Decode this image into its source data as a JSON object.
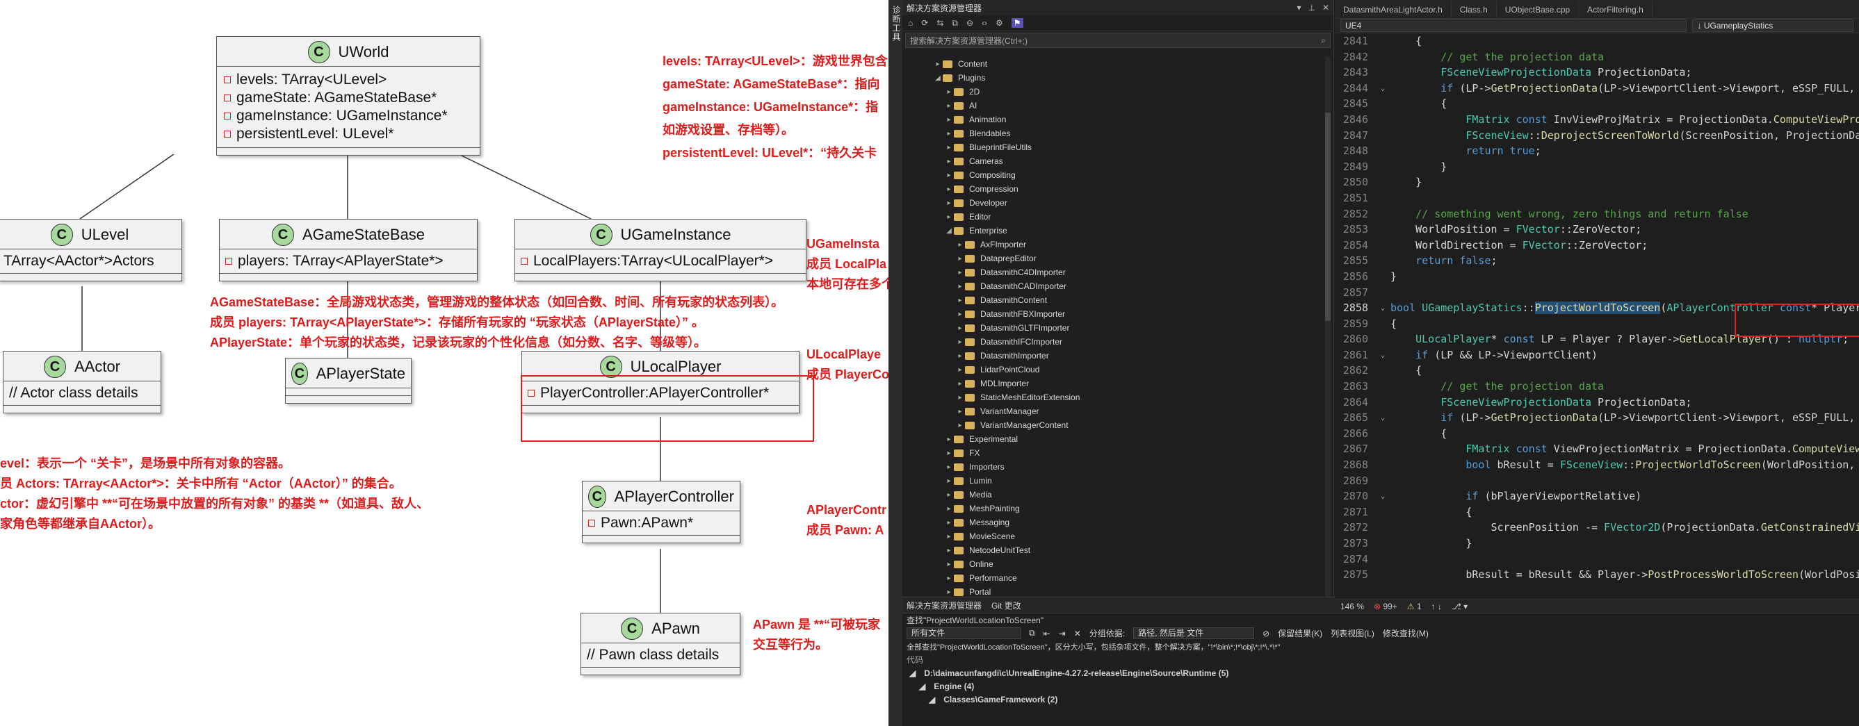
{
  "uml": {
    "classes": {
      "uworld": {
        "icon": "C",
        "name": "UWorld",
        "attrs": [
          "levels: TArray<ULevel>",
          "gameState: AGameStateBase*",
          "gameInstance: UGameInstance*",
          "persistentLevel: ULevel*"
        ]
      },
      "ulevel": {
        "icon": "C",
        "name": "ULevel",
        "attrs": [
          "TArray<AActor*>Actors"
        ]
      },
      "agamestatebase": {
        "icon": "C",
        "name": "AGameStateBase",
        "attrs": [
          "players: TArray<APlayerState*>"
        ]
      },
      "ugameinstance": {
        "icon": "C",
        "name": "UGameInstance",
        "attrs": [
          "LocalPlayers:TArray<ULocalPlayer*>"
        ]
      },
      "aactor": {
        "icon": "C",
        "name": "AActor",
        "attrs": [
          "// Actor class details"
        ]
      },
      "aplayerstate": {
        "icon": "C",
        "name": "APlayerState",
        "attrs": []
      },
      "ulocalplayer": {
        "icon": "C",
        "name": "ULocalPlayer",
        "attrs": [
          "PlayerController:APlayerController*"
        ]
      },
      "aplayercontroller": {
        "icon": "C",
        "name": "APlayerController",
        "attrs": [
          "Pawn:APawn*"
        ]
      },
      "apawn": {
        "icon": "C",
        "name": "APawn",
        "attrs": [
          "// Pawn class details"
        ]
      }
    },
    "notes": {
      "uworld": [
        "levels: TArray<ULevel>：游戏世界包含",
        "gameState: AGameStateBase*：指向",
        "gameInstance: UGameInstance*：指",
        "如游戏设置、存档等）。",
        "persistentLevel: ULevel*：“持久关卡"
      ],
      "agamestate": [
        "AGameStateBase：全局游戏状态类，管理游戏的整体状态（如回合数、时间、所有玩家的状态列表）。",
        "成员 players: TArray<APlayerState*>：存储所有玩家的 “玩家状态（APlayerState）” 。",
        "APlayerState：单个玩家的状态类，记录该玩家的个性化信息（如分数、名字、等级等）。"
      ],
      "ugameinstance": [
        "UGameInsta",
        "成员 LocalPla",
        "本地可存在多个"
      ],
      "ulocalplayer": [
        "ULocalPlaye",
        "成员 PlayerCo"
      ],
      "ulevel": [
        "evel：表示一个 “关卡”，是场景中所有对象的容器。",
        "员 Actors: TArray<AActor*>：关卡中所有 “Actor（AActor）” 的集合。",
        "ctor：虚幻引擎中 **“可在场景中放置的所有对象” 的基类 **（如道具、敌人、",
        "家角色等都继承自AActor）。"
      ],
      "aplayercontroller": [
        "APlayerContr",
        "成员 Pawn: A"
      ],
      "apawn": [
        "APawn 是 **“可被玩家",
        "交互等行为。"
      ]
    }
  },
  "vs": {
    "side_toolbar_text": "诊断工具",
    "solution_explorer": {
      "title": "解决方案资源管理器",
      "title_controls": [
        "▾",
        "⊥",
        "✕"
      ],
      "search_placeholder": "搜索解决方案资源管理器(Ctrl+;)",
      "search_icon": "⌕",
      "toolbar_icons": [
        "⌂",
        "⟳",
        "⇆",
        "⧉",
        "⊖",
        "‹›",
        "⚙",
        "⚑"
      ],
      "tree": [
        {
          "label": "Content",
          "level": 1,
          "expand": "▸"
        },
        {
          "label": "Plugins",
          "level": 1,
          "expand": "◢"
        },
        {
          "label": "2D",
          "level": 2,
          "expand": "▸"
        },
        {
          "label": "AI",
          "level": 2,
          "expand": "▸"
        },
        {
          "label": "Animation",
          "level": 2,
          "expand": "▸"
        },
        {
          "label": "Blendables",
          "level": 2,
          "expand": "▸"
        },
        {
          "label": "BlueprintFileUtils",
          "level": 2,
          "expand": "▸"
        },
        {
          "label": "Cameras",
          "level": 2,
          "expand": "▸"
        },
        {
          "label": "Compositing",
          "level": 2,
          "expand": "▸"
        },
        {
          "label": "Compression",
          "level": 2,
          "expand": "▸"
        },
        {
          "label": "Developer",
          "level": 2,
          "expand": "▸"
        },
        {
          "label": "Editor",
          "level": 2,
          "expand": "▸"
        },
        {
          "label": "Enterprise",
          "level": 2,
          "expand": "◢"
        },
        {
          "label": "AxFImporter",
          "level": 3,
          "expand": "▸"
        },
        {
          "label": "DataprepEditor",
          "level": 3,
          "expand": "▸"
        },
        {
          "label": "DatasmithC4DImporter",
          "level": 3,
          "expand": "▸"
        },
        {
          "label": "DatasmithCADImporter",
          "level": 3,
          "expand": "▸"
        },
        {
          "label": "DatasmithContent",
          "level": 3,
          "expand": "▸"
        },
        {
          "label": "DatasmithFBXImporter",
          "level": 3,
          "expand": "▸"
        },
        {
          "label": "DatasmithGLTFImporter",
          "level": 3,
          "expand": "▸"
        },
        {
          "label": "DatasmithIFCImporter",
          "level": 3,
          "expand": "▸"
        },
        {
          "label": "DatasmithImporter",
          "level": 3,
          "expand": "▸"
        },
        {
          "label": "LidarPointCloud",
          "level": 3,
          "expand": "▸"
        },
        {
          "label": "MDLImporter",
          "level": 3,
          "expand": "▸"
        },
        {
          "label": "StaticMeshEditorExtension",
          "level": 3,
          "expand": "▸"
        },
        {
          "label": "VariantManager",
          "level": 3,
          "expand": "▸"
        },
        {
          "label": "VariantManagerContent",
          "level": 3,
          "expand": "▸"
        },
        {
          "label": "Experimental",
          "level": 2,
          "expand": "▸"
        },
        {
          "label": "FX",
          "level": 2,
          "expand": "▸"
        },
        {
          "label": "Importers",
          "level": 2,
          "expand": "▸"
        },
        {
          "label": "Lumin",
          "level": 2,
          "expand": "▸"
        },
        {
          "label": "Media",
          "level": 2,
          "expand": "▸"
        },
        {
          "label": "MeshPainting",
          "level": 2,
          "expand": "▸"
        },
        {
          "label": "Messaging",
          "level": 2,
          "expand": "▸"
        },
        {
          "label": "MovieScene",
          "level": 2,
          "expand": "▸"
        },
        {
          "label": "NetcodeUnitTest",
          "level": 2,
          "expand": "▸"
        },
        {
          "label": "Online",
          "level": 2,
          "expand": "▸"
        },
        {
          "label": "Performance",
          "level": 2,
          "expand": "▸"
        },
        {
          "label": "Portal",
          "level": 2,
          "expand": "▸"
        }
      ],
      "bottom_tabs": [
        "解决方案资源管理器",
        "Git 更改"
      ]
    },
    "editor": {
      "tabs": [
        "DatasmithAreaLightActor.h",
        "Class.h",
        "UObjectBase.cpp",
        "ActorFiltering.h"
      ],
      "nav_project": "UE4",
      "nav_scope": "↓ UGameplayStatics",
      "status": {
        "zoom": "146 %",
        "errors": "99+",
        "warnings": "1",
        "arrows": "↑ ↓",
        "branch": "⎇ ▾"
      }
    },
    "find_results": {
      "title": "查找\"ProjectWorldLocationToScreen\"",
      "scope": "所有文件",
      "group_label": "分组依据:",
      "group_value": "路径, 然后是 文件",
      "keep_results": "保留结果(K)",
      "list_view": "列表视图(L)",
      "modify_find": "修改查找(M)",
      "summary": "全部查找\"ProjectWorldLocationToScreen\"，区分大小写，包括杂项文件，整个解决方案，\"!*\\bin\\*;!*\\obj\\*;!*\\.*\\*\"",
      "column": "代码",
      "rows": [
        "D:\\daimacunfangdi\\c\\UnrealEngine-4.27.2-release\\Engine\\Source\\Runtime (5)",
        "Engine (4)",
        "Classes\\GameFramework (2)"
      ]
    }
  }
}
